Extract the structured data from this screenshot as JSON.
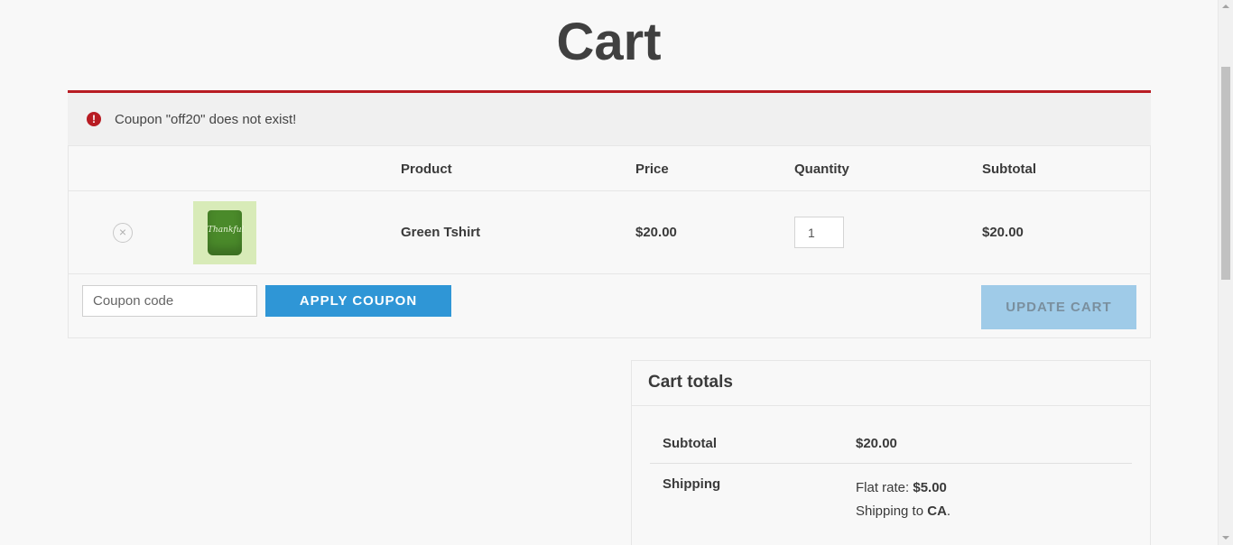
{
  "page": {
    "title": "Cart"
  },
  "notice": {
    "text": "Coupon \"off20\" does not exist!",
    "icon": "exclamation-circle-icon"
  },
  "cart_table": {
    "headers": {
      "product": "Product",
      "price": "Price",
      "quantity": "Quantity",
      "subtotal": "Subtotal"
    },
    "items": [
      {
        "remove_icon": "×",
        "thumbnail_text": "Thankful",
        "product": "Green Tshirt",
        "price": "$20.00",
        "quantity": "1",
        "subtotal": "$20.00"
      }
    ],
    "actions": {
      "coupon_placeholder": "Coupon code",
      "apply_label": "Apply coupon",
      "update_label": "Update cart"
    }
  },
  "cart_totals": {
    "title": "Cart totals",
    "subtotal_label": "Subtotal",
    "subtotal_value": "$20.00",
    "shipping_label": "Shipping",
    "shipping_method_prefix": "Flat rate: ",
    "shipping_method_price": "$5.00",
    "shipping_to_prefix": "Shipping to ",
    "shipping_to_region": "CA",
    "shipping_to_suffix": "."
  },
  "colors": {
    "error_accent": "#b81c23",
    "primary_button": "#2f96d6",
    "disabled_button": "#9fcbe8"
  }
}
